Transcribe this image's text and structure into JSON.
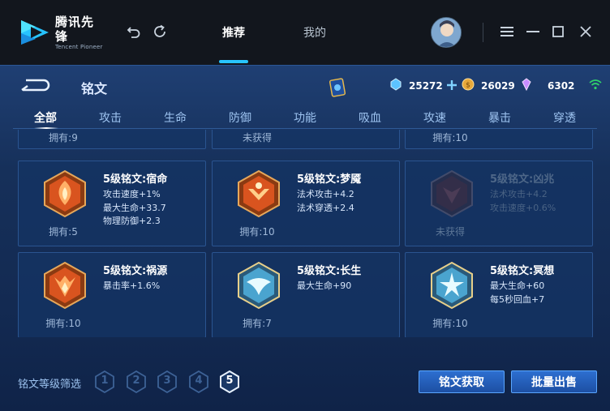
{
  "app": {
    "logo_cn": "腾讯先锋",
    "logo_en": "Tencent Pioneer"
  },
  "nav": {
    "tabs": [
      {
        "label": "推荐",
        "active": true
      },
      {
        "label": "我的",
        "active": false
      }
    ]
  },
  "panel": {
    "title": "铭文",
    "currencies": [
      {
        "icon": "blue-crystal-icon",
        "amount": "25272",
        "has_add": true
      },
      {
        "icon": "gold-coin-icon",
        "amount": "26029",
        "has_add": false
      },
      {
        "icon": "purple-diamond-icon",
        "amount": "6302",
        "has_add": false
      }
    ],
    "categories": [
      "全部",
      "攻击",
      "生命",
      "防御",
      "功能",
      "吸血",
      "攻速",
      "暴击",
      "穿透"
    ],
    "active_category": "全部"
  },
  "partial_row": [
    {
      "owned": "拥有:9"
    },
    {
      "owned": "未获得"
    },
    {
      "owned": "拥有:10"
    }
  ],
  "cards": [
    {
      "name": "5级铭文:宿命",
      "stats": [
        "攻击速度+1%",
        "最大生命+33.7",
        "物理防御+2.3"
      ],
      "owned": "拥有:5",
      "locked": false,
      "color": "#e0642a"
    },
    {
      "name": "5级铭文:梦魇",
      "stats": [
        "法术攻击+4.2",
        "法术穿透+2.4"
      ],
      "owned": "拥有:10",
      "locked": false,
      "color": "#e0642a"
    },
    {
      "name": "5级铭文:凶兆",
      "stats": [
        "法术攻击+4.2",
        "攻击速度+0.6%"
      ],
      "owned": "未获得",
      "locked": true,
      "color": "#8a3a3a"
    },
    {
      "name": "5级铭文:祸源",
      "stats": [
        "暴击率+1.6%"
      ],
      "owned": "拥有:10",
      "locked": false,
      "color": "#e0642a"
    },
    {
      "name": "5级铭文:长生",
      "stats": [
        "最大生命+90"
      ],
      "owned": "拥有:7",
      "locked": false,
      "color": "#6cc6e8"
    },
    {
      "name": "5级铭文:冥想",
      "stats": [
        "最大生命+60",
        "每5秒回血+7"
      ],
      "owned": "拥有:10",
      "locked": false,
      "color": "#6cc6e8"
    }
  ],
  "footer": {
    "filter_label": "铭文等级筛选",
    "levels": [
      "1",
      "2",
      "3",
      "4",
      "5"
    ],
    "active_level": "5",
    "obtain_button": "铭文获取",
    "sell_button": "批量出售"
  }
}
